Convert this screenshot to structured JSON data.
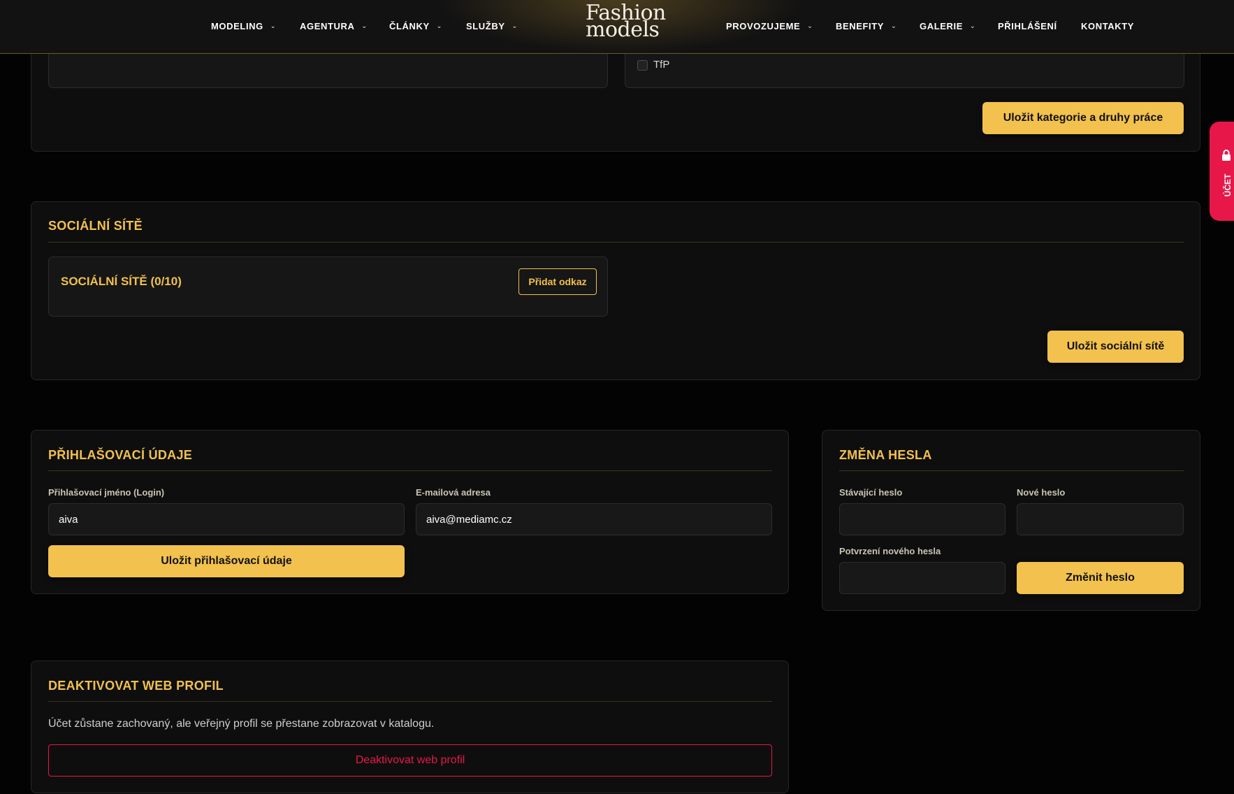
{
  "nav": {
    "left_items": [
      {
        "label": "MODELING"
      },
      {
        "label": "AGENTURA"
      },
      {
        "label": "ČLÁNKY"
      },
      {
        "label": "SLUŽBY"
      }
    ],
    "logo": {
      "line1": "Fashion",
      "line2": "models"
    },
    "right_items": [
      {
        "label": "PROVOZUJEME",
        "has_dropdown": true
      },
      {
        "label": "BENEFITY",
        "has_dropdown": true
      },
      {
        "label": "GALERIE",
        "has_dropdown": true
      },
      {
        "label": "PŘIHLÁŠENÍ",
        "has_dropdown": false
      },
      {
        "label": "KONTAKTY",
        "has_dropdown": false
      }
    ],
    "chevron": "⌄"
  },
  "categories": {
    "checkbox_label": "TfP",
    "save_label": "Uložit kategorie a druhy práce"
  },
  "social": {
    "title": "SOCIÁLNÍ SÍTĚ",
    "box_title": "SOCIÁLNÍ SÍTĚ (0/10)",
    "add_label": "Přidat odkaz",
    "save_label": "Uložit sociální sítě"
  },
  "login": {
    "title": "PŘIHLAŠOVACÍ ÚDAJE",
    "username_label": "Přihlašovací jméno (Login)",
    "username_value": "aiva",
    "email_label": "E-mailová adresa",
    "email_value": "aiva@mediamc.cz",
    "save_label": "Uložit přihlašovací údaje"
  },
  "password": {
    "title": "ZMĚNA HESLA",
    "current_label": "Stávající heslo",
    "new_label": "Nové heslo",
    "confirm_label": "Potvrzení nového hesla",
    "submit_label": "Změnit heslo"
  },
  "deactivate": {
    "title": "DEAKTIVOVAT WEB PROFIL",
    "description": "Účet zůstane zachovaný, ale veřejný profil se přestane zobrazovat v katalogu.",
    "button_label": "Deaktivovat web profil"
  },
  "side_tab": {
    "label": "ÚČET",
    "icon": "lock-icon"
  },
  "colors": {
    "accent": "#f2c14e",
    "danger": "#e8174a",
    "background": "#030303"
  }
}
